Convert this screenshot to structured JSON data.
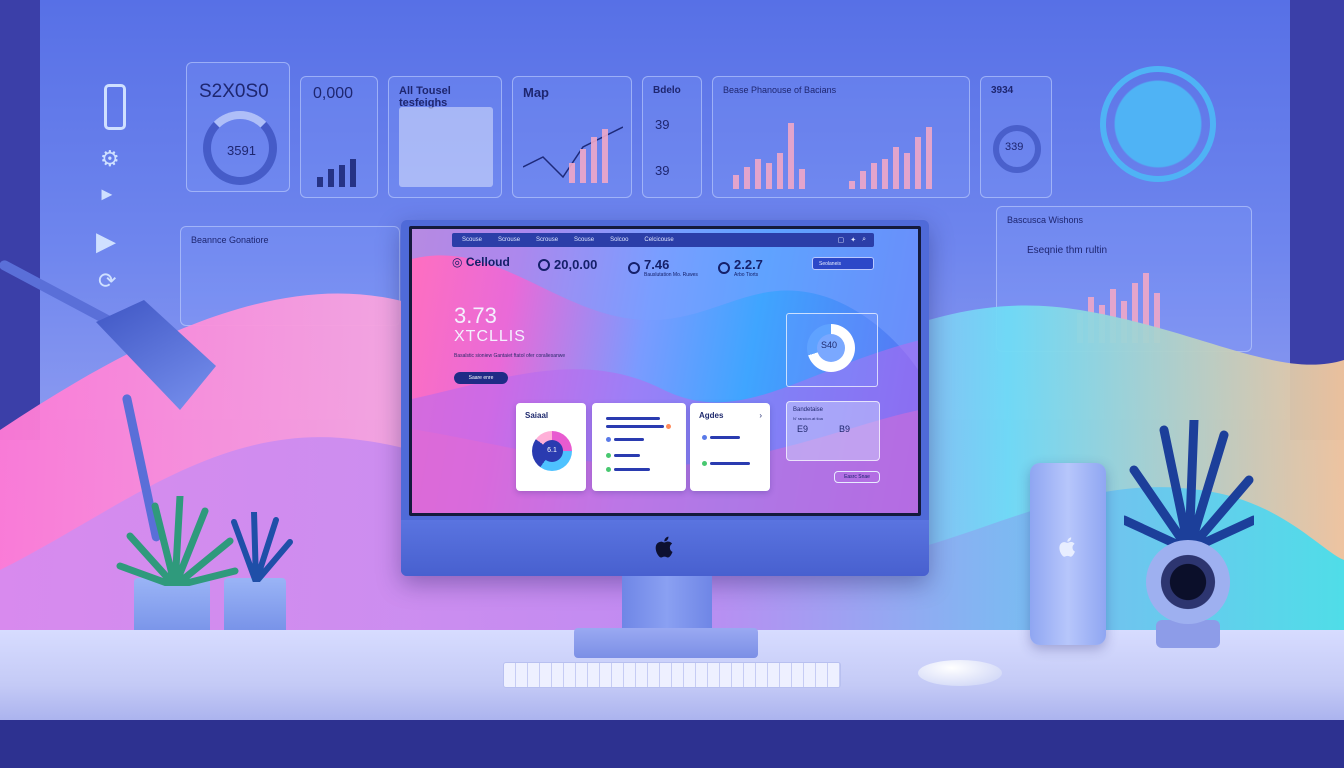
{
  "wall_panels": {
    "p1": {
      "value": "S2X0S0"
    },
    "p1_ring": "3591",
    "p2": {
      "value": "0,000"
    },
    "p3": {
      "title": "All Tousel tesfeighs"
    },
    "p4": {
      "title": "Map"
    },
    "p5": {
      "label": "Bdelo",
      "value_a": "39",
      "value_b": "39"
    },
    "p6": {
      "title": "Bease Phanouse of Bacians"
    },
    "p7": {
      "title": "3934",
      "ring": "339"
    },
    "p8": {
      "title": "Bascusca Wishons",
      "subtitle": "Eseqnie thm rultin"
    },
    "p9": {
      "title": "Beannce Gonatiore"
    }
  },
  "screen": {
    "nav": [
      "Scouse",
      "Scrouse",
      "Scrouse",
      "Scouse",
      "Solcoo",
      "Celcicouse"
    ],
    "brand": "Celloud",
    "stats": [
      {
        "value": "20,0.00",
        "caption": ""
      },
      {
        "value": "7.46",
        "caption": "Bauslutation Mo. Ruwes"
      },
      {
        "value": "2.2.7",
        "caption": "Arbo Tiorts"
      }
    ],
    "search_label": "Seolaneis",
    "hero_number": "3.73",
    "hero_subtitle": "XTCLLIS",
    "hero_text": "Basalstic sioniew Gantaiet ftatol ofer coraliesanwe",
    "hero_button": "Saare enre",
    "donut_value": "S40",
    "card1_title": "Saiaal",
    "card1_value": "6.1",
    "card3_title": "Agdes",
    "glass_title": "Bandetaise",
    "glass_sub": "N' rancion.at tioa",
    "glass_val1": "E9",
    "glass_val2": "B9",
    "small_button": "Easrc Snae"
  },
  "colors": {
    "accent": "#2a3bb0",
    "pink": "#ff6fbf",
    "cyan": "#3fe0f0"
  },
  "icons": [
    "phone-icon",
    "gear-icon",
    "play-icon",
    "refresh-icon",
    "apple-logo-icon",
    "lock-icon",
    "star-icon",
    "search-icon"
  ]
}
